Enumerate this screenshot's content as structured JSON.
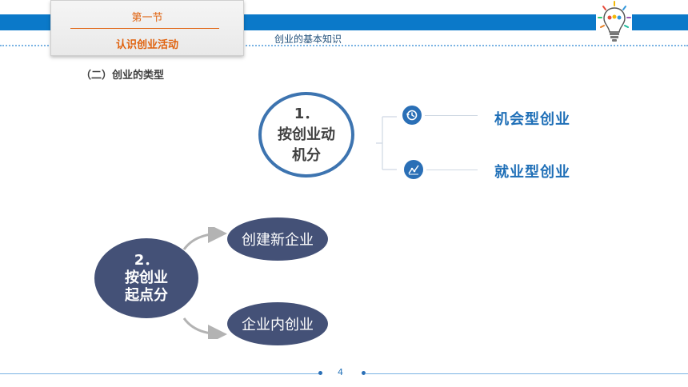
{
  "header": {
    "section_number": "第一节",
    "section_title": "认识创业活动",
    "subtitle": "创业的基本知识"
  },
  "heading": "（二）创业的类型",
  "motive": {
    "number": "1．",
    "line1": "按创业动",
    "line2": "机分",
    "types": [
      {
        "label": "机会型创业",
        "icon": "history-icon"
      },
      {
        "label": "就业型创业",
        "icon": "chart-icon"
      }
    ]
  },
  "origin": {
    "number": "2．",
    "line1": "按创业",
    "line2": "起点分",
    "types": [
      {
        "label": "创建新企业"
      },
      {
        "label": "企业内创业"
      }
    ]
  },
  "footer": {
    "page_number": "4"
  },
  "colors": {
    "brand_blue": "#0b79c9",
    "accent_orange": "#e0620e",
    "navy": "#445177"
  }
}
